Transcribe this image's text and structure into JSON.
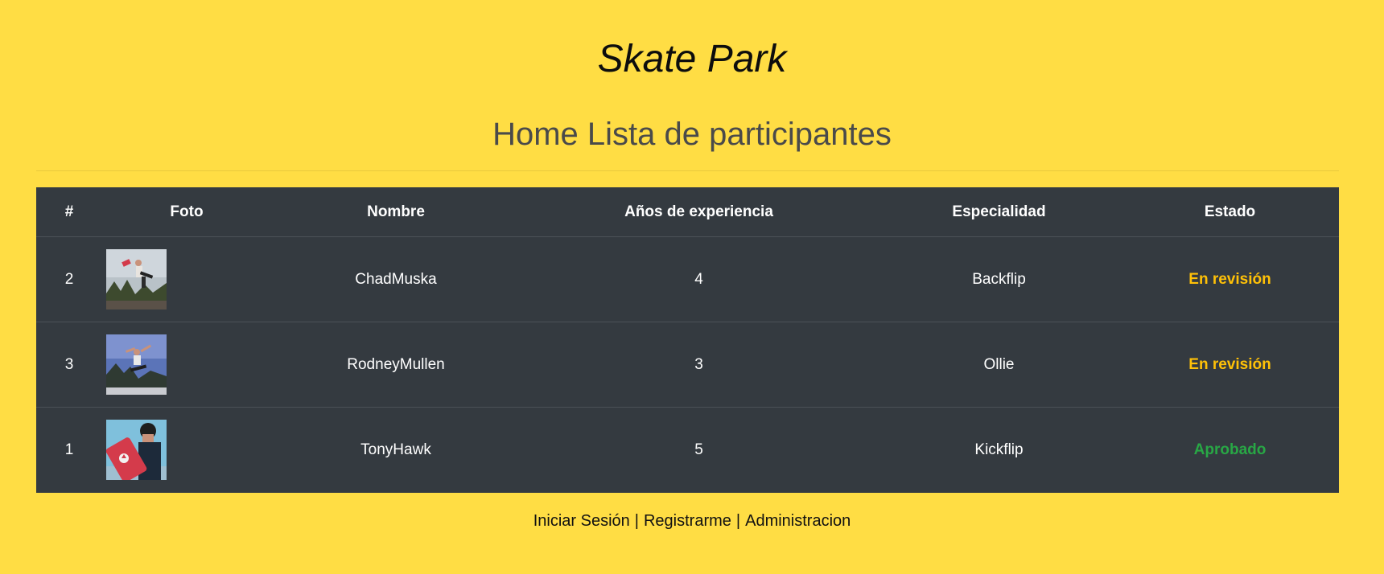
{
  "site": {
    "title": "Skate Park"
  },
  "page": {
    "heading": "Home Lista de participantes"
  },
  "table": {
    "headers": [
      "#",
      "Foto",
      "Nombre",
      "Años de experiencia",
      "Especialidad",
      "Estado"
    ],
    "rows": [
      {
        "id": "2",
        "nombre": "ChadMuska",
        "anos": "4",
        "especialidad": "Backflip",
        "estado": "En revisión",
        "photo": "chad-photo"
      },
      {
        "id": "3",
        "nombre": "RodneyMullen",
        "anos": "3",
        "especialidad": "Ollie",
        "estado": "En revisión",
        "photo": "rodney-photo"
      },
      {
        "id": "1",
        "nombre": "TonyHawk",
        "anos": "5",
        "especialidad": "Kickflip",
        "estado": "Aprobado",
        "photo": "tony-photo"
      }
    ]
  },
  "footer": {
    "login": "Iniciar Sesión",
    "separator": "|",
    "register": "Registrarme",
    "admin": "Administracion"
  },
  "colors": {
    "background": "#ffdd44",
    "table_bg": "#343a40",
    "status_review": "#ffc107",
    "status_approved": "#28a745"
  }
}
